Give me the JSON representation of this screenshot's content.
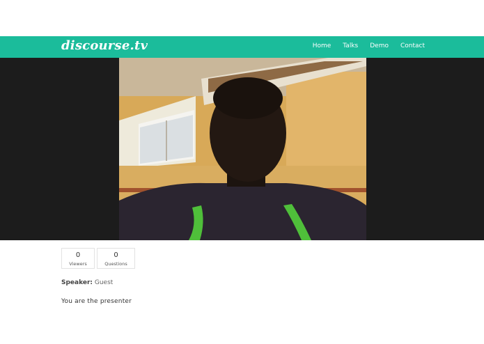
{
  "navbar": {
    "brand": "discourse.tv",
    "links": [
      {
        "label": "Home"
      },
      {
        "label": "Talks"
      },
      {
        "label": "Demo"
      },
      {
        "label": "Contact"
      }
    ]
  },
  "stats": {
    "viewers": {
      "value": "0",
      "label": "Viewers"
    },
    "questions": {
      "value": "0",
      "label": "Questions"
    }
  },
  "speaker": {
    "label": "Speaker:",
    "name": "Guest"
  },
  "presenter_notice": "You are the presenter",
  "colors": {
    "navbar": "#1bbc9b",
    "video_background": "#1c1c1c"
  }
}
